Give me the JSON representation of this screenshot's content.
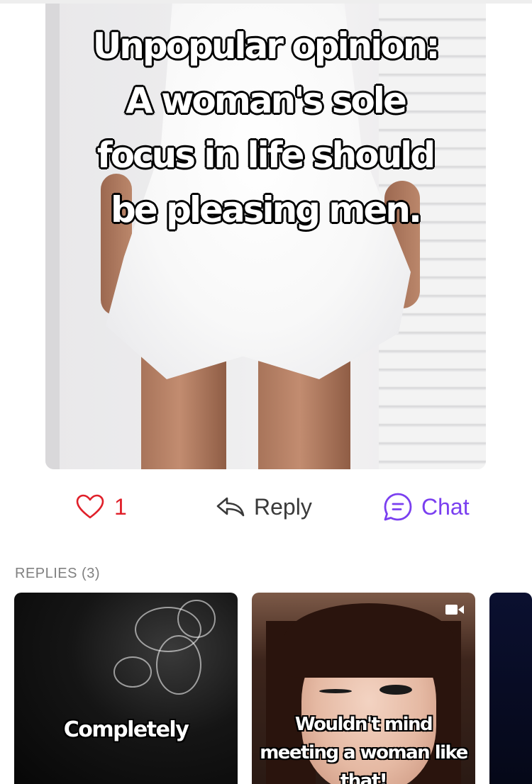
{
  "post": {
    "text": "Unpopular opinion: A woman's sole focus in life should be pleasing men."
  },
  "actions": {
    "like_count": "1",
    "reply_label": "Reply",
    "chat_label": "Chat"
  },
  "replies": {
    "heading": "REPLIES (3)",
    "items": [
      {
        "text": "Completely"
      },
      {
        "text": "Wouldn't mind meeting a woman like that!",
        "icon": "video-camera-icon"
      },
      {
        "text": ""
      }
    ]
  },
  "colors": {
    "like": "#e0202a",
    "chat": "#7a3ff0",
    "reply": "#3a3a3a",
    "muted": "#808080"
  }
}
